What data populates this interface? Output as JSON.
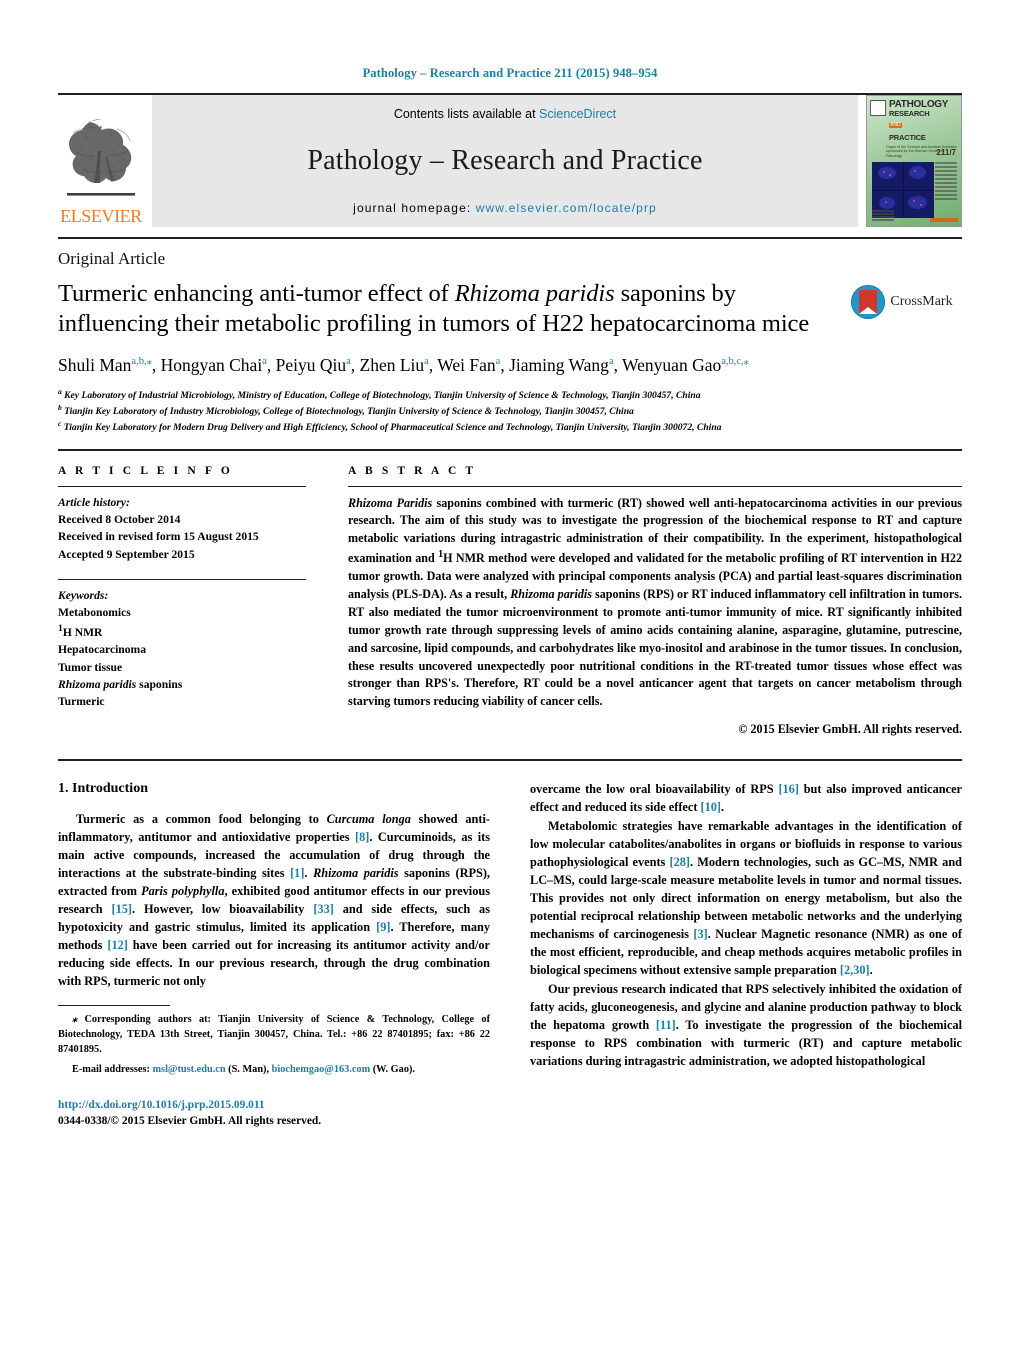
{
  "running_head": "Pathology – Research and Practice 211 (2015) 948–954",
  "masthead": {
    "contents_prefix": "Contents lists available at ",
    "contents_link": "ScienceDirect",
    "journal_title": "Pathology – Research and Practice",
    "homepage_label": "journal homepage:",
    "homepage_url": "www.elsevier.com/locate/prp",
    "publisher_logo_text": "ELSEVIER",
    "cover": {
      "line1": "PATHOLOGY",
      "line2": "RESEARCH",
      "and": "AND",
      "line3": "PRACTICE",
      "volume": "211/7",
      "sub": "Organ of the German and Austrian Societies sponsored by the German Society of Pathology"
    }
  },
  "article": {
    "category": "Original Article",
    "title_html": "Turmeric enhancing anti-tumor effect of <i>Rhizoma paridis</i> saponins by influencing their metabolic profiling in tumors of H22 hepatocarcinoma mice",
    "crossmark_label": "CrossMark",
    "authors_html": "Shuli Man<sup>a,b,⁎</sup>, Hongyan Chai<sup>a</sup>, Peiyu Qiu<sup>a</sup>, Zhen Liu<sup>a</sup>, Wei Fan<sup>a</sup>, Jiaming Wang<sup>a</sup>, Wenyuan Gao<sup>a,b,c,⁎</sup>",
    "affiliations": [
      "<sup>a</sup> Key Laboratory of Industrial Microbiology, Ministry of Education, College of Biotechnology, Tianjin University of Science &amp; Technology, Tianjin 300457, China",
      "<sup>b</sup> Tianjin Key Laboratory of Industry Microbiology, College of Biotechnology, Tianjin University of Science &amp; Technology, Tianjin 300457, China",
      "<sup>c</sup> Tianjin Key Laboratory for Modern Drug Delivery and High Efficiency, School of Pharmaceutical Science and Technology, Tianjin University, Tianjin 300072, China"
    ]
  },
  "article_info": {
    "heading": "A R T I C L E   I N F O",
    "history_label": "Article history:",
    "history": [
      "Received 8 October 2014",
      "Received in revised form 15 August 2015",
      "Accepted 9 September 2015"
    ],
    "keywords_label": "Keywords:",
    "keywords_html": [
      "Metabonomics",
      "<sup>1</sup>H NMR",
      "Hepatocarcinoma",
      "Tumor tissue",
      "<i>Rhizoma paridis</i> saponins",
      "Turmeric"
    ]
  },
  "abstract": {
    "heading": "A B S T R A C T",
    "text_html": "<i>Rhizoma Paridis</i> saponins combined with turmeric (RT) showed well anti-hepatocarcinoma activities in our previous research. The aim of this study was to investigate the progression of the biochemical response to RT and capture metabolic variations during intragastric administration of their compatibility. In the experiment, histopathological examination and <sup>1</sup>H NMR method were developed and validated for the metabolic profiling of RT intervention in H22 tumor growth. Data were analyzed with principal components analysis (PCA) and partial least-squares discrimination analysis (PLS-DA). As a result, <i>Rhizoma paridis</i> saponins (RPS) or RT induced inflammatory cell infiltration in tumors. RT also mediated the tumor microenvironment to promote anti-tumor immunity of mice. RT significantly inhibited tumor growth rate through suppressing levels of amino acids containing alanine, asparagine, glutamine, putrescine, and sarcosine, lipid compounds, and carbohydrates like myo-inositol and arabinose in the tumor tissues. In conclusion, these results uncovered unexpectedly poor nutritional conditions in the RT-treated tumor tissues whose effect was stronger than RPS's. Therefore, RT could be a novel anticancer agent that targets on cancer metabolism through starving tumors reducing viability of cancer cells.",
    "copyright": "© 2015 Elsevier GmbH. All rights reserved."
  },
  "body": {
    "section_heading": "1.  Introduction",
    "left_paragraphs_html": [
      "Turmeric as a common food belonging to <i>Curcuma longa</i> showed anti-inflammatory, antitumor and antioxidative properties <span class=\"ref\">[8]</span>. Curcuminoids, as its main active compounds, increased the accumulation of drug through the interactions at the substrate-binding sites <span class=\"ref\">[1]</span>. <i>Rhizoma paridis</i> saponins (RPS), extracted from <i>Paris polyphylla</i>, exhibited good antitumor effects in our previous research <span class=\"ref\">[15]</span>. However, low bioavailability <span class=\"ref\">[33]</span> and side effects, such as hypotoxicity and gastric stimulus, limited its application <span class=\"ref\">[9]</span>. Therefore, many methods <span class=\"ref\">[12]</span> have been carried out for increasing its antitumor activity and/or reducing side effects. In our previous research, through the drug combination with RPS, turmeric not only"
    ],
    "right_paragraphs_html": [
      "overcame the low oral bioavailability of RPS <span class=\"ref\">[16]</span> but also improved anticancer effect and reduced its side effect <span class=\"ref\">[10]</span>.",
      "Metabolomic strategies have remarkable advantages in the identification of low molecular catabolites/anabolites in organs or biofluids in response to various pathophysiological events <span class=\"ref\">[28]</span>. Modern technologies, such as GC–MS, NMR and LC–MS, could large-scale measure metabolite levels in tumor and normal tissues. This provides not only direct information on energy metabolism, but also the potential reciprocal relationship between metabolic networks and the underlying mechanisms of carcinogenesis <span class=\"ref\">[3]</span>. Nuclear Magnetic resonance (NMR) as one of the most efficient, reproducible, and cheap methods acquires metabolic profiles in biological specimens without extensive sample preparation <span class=\"ref\">[2,30]</span>.",
      "Our previous research indicated that RPS selectively inhibited the oxidation of fatty acids, gluconeogenesis, and glycine and alanine production pathway to block the hepatoma growth <span class=\"ref\">[11]</span>. To investigate the progression of the biochemical response to RPS combination with turmeric (RT) and capture metabolic variations during intragastric administration, we adopted histopathological"
    ]
  },
  "footnote": {
    "corresponding_html": "<span class=\"lab\">⁎</span> Corresponding authors at: Tianjin University of Science &amp; Technology, College of Biotechnology, TEDA 13th Street, Tianjin 300457, China. Tel.: +86 22 87401895; fax: +86 22 87401895.",
    "emails_html": "<span class=\"lab\">E-mail addresses:</span> <a class=\"link\" href=\"#\">msl@tust.edu.cn</a> (S. Man), <a class=\"link\" href=\"#\">biochemgao@163.com</a> (W. Gao).",
    "doi": "http://dx.doi.org/10.1016/j.prp.2015.09.011",
    "issn_line": "0344-0338/© 2015 Elsevier GmbH. All rights reserved."
  }
}
